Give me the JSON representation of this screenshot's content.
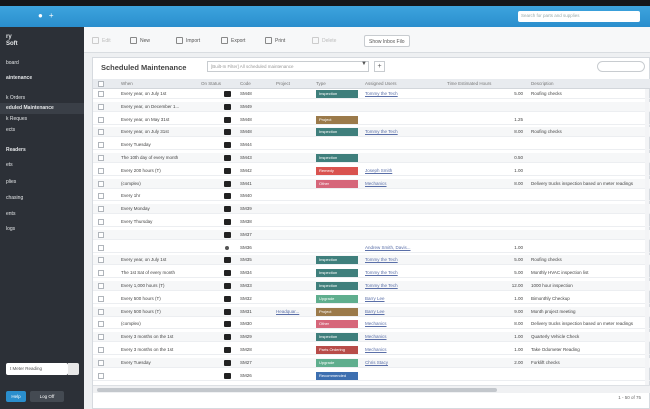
{
  "topbar": {
    "user_icon": "user-icon",
    "plus_label": "+",
    "search_placeholder": "Search for parts and supplies"
  },
  "sidebar": {
    "logo": [
      "ry",
      "Soft"
    ],
    "items": [
      {
        "label": "board"
      },
      {
        "label": "aintenance"
      },
      {
        "label": "k Orders"
      },
      {
        "label": "eduled Maintenance"
      },
      {
        "label": "k Reques"
      },
      {
        "label": "ects"
      },
      {
        "label": "Readers"
      },
      {
        "label": "ets"
      },
      {
        "label": "plies"
      },
      {
        "label": "chasing"
      },
      {
        "label": "ents"
      },
      {
        "label": "logs"
      }
    ],
    "meter_label": "t Meter Reading",
    "help_label": "Help",
    "logout_label": "Log Off"
  },
  "toolbar": {
    "edit": "Edit",
    "new": "New",
    "import": "Import",
    "export": "Export",
    "print": "Print",
    "delete": "Delete",
    "show_inbox": "Show Inbox Filo"
  },
  "panel": {
    "title": "Scheduled Maintenance",
    "filter": "[Built-In Filter] All scheduled maintenance",
    "add": "+",
    "pager": "1 - 50 of 75"
  },
  "columns": [
    "When",
    "On Status",
    "Code",
    "Project",
    "Type",
    "Assigned Users",
    "Time Estimated Hours",
    "Description"
  ],
  "colors": {
    "Inspection": "#3f7f7c",
    "Project": "#9b7a4a",
    "Remedy": "#d9534f",
    "Other": "#d6667a",
    "Upgrade": "#5fae8e",
    "Preventive": "#3b7c78",
    "Parts Ordering": "#b84c49",
    "Recommended": "#3d6fb0"
  },
  "rows": [
    {
      "when": "Every year, on July 1st",
      "status": "on",
      "code": "SM48",
      "project": "",
      "type": "Inspection",
      "assigned": "Tommy the Tech",
      "hours": "5.00",
      "desc": "Roofing checks"
    },
    {
      "when": "Every year, on December 1...",
      "status": "on",
      "code": "SM49",
      "project": "",
      "type": "",
      "assigned": "",
      "hours": "",
      "desc": ""
    },
    {
      "when": "Every year, on May 31st",
      "status": "on",
      "code": "SM48",
      "project": "",
      "type": "Project",
      "assigned": "",
      "hours": "1.25",
      "desc": ""
    },
    {
      "when": "Every year, on July 31st",
      "status": "on",
      "code": "SM48",
      "project": "",
      "type": "Inspection",
      "assigned": "Tommy the Tech",
      "hours": "8.00",
      "desc": "Roofing checks"
    },
    {
      "when": "Every Tuesday",
      "status": "on",
      "code": "SM44",
      "project": "",
      "type": "",
      "assigned": "",
      "hours": "",
      "desc": ""
    },
    {
      "when": "The 10th day of every month",
      "status": "on",
      "code": "SM43",
      "project": "",
      "type": "Inspection",
      "assigned": "",
      "hours": "0.50",
      "desc": ""
    },
    {
      "when": "Every 200 hours (T)",
      "status": "off",
      "code": "SM42",
      "project": "",
      "type": "Remedy",
      "assigned": "Joseph Smith",
      "hours": "1.00",
      "desc": ""
    },
    {
      "when": "(complex)",
      "status": "off",
      "code": "SM41",
      "project": "",
      "type": "Other",
      "assigned": "Mechanics",
      "hours": "8.00",
      "desc": "Delivery trucks inspection based on meter readings"
    },
    {
      "when": "Every 1hr",
      "status": "off",
      "code": "SM40",
      "project": "",
      "type": "",
      "assigned": "",
      "hours": "",
      "desc": ""
    },
    {
      "when": "Every Monday",
      "status": "off",
      "code": "SM39",
      "project": "",
      "type": "",
      "assigned": "",
      "hours": "",
      "desc": ""
    },
    {
      "when": "Every Thursday",
      "status": "off",
      "code": "SM38",
      "project": "",
      "type": "",
      "assigned": "",
      "hours": "",
      "desc": ""
    },
    {
      "when": "",
      "status": "on",
      "code": "SM37",
      "project": "",
      "type": "",
      "assigned": "",
      "hours": "",
      "desc": ""
    },
    {
      "when": "",
      "status": "dim",
      "code": "SM36",
      "project": "",
      "type": "",
      "assigned": "Andrew Smith, Davis...",
      "hours": "1.00",
      "desc": ""
    },
    {
      "when": "Every year, on July 1st",
      "status": "off",
      "code": "SM35",
      "project": "",
      "type": "Inspection",
      "assigned": "Tommy the Tech",
      "hours": "5.00",
      "desc": "Roofing checks"
    },
    {
      "when": "The 1st Sat of every month",
      "status": "off",
      "code": "SM34",
      "project": "",
      "type": "Inspection",
      "assigned": "Tommy the Tech",
      "hours": "5.00",
      "desc": "Monthly HVAC inspection list"
    },
    {
      "when": "Every 1,000 hours (T)",
      "status": "off",
      "code": "SM33",
      "project": "",
      "type": "Inspection",
      "assigned": "Tommy the Tech",
      "hours": "12.00",
      "desc": "1000 hour inspection"
    },
    {
      "when": "Every 500 hours (T)",
      "status": "off",
      "code": "SM32",
      "project": "",
      "type": "Upgrade",
      "assigned": "Barry Lee",
      "hours": "1.00",
      "desc": "Bimonthly Checkup"
    },
    {
      "when": "Every 500 hours (T)",
      "status": "off",
      "code": "SM31",
      "project": "Headquar...",
      "type": "Project",
      "assigned": "Barry Lee",
      "hours": "9.00",
      "desc": "Month project meeting"
    },
    {
      "when": "(complex)",
      "status": "off",
      "code": "SM30",
      "project": "",
      "type": "Other",
      "assigned": "Mechanics",
      "hours": "8.00",
      "desc": "Delivery trucks inspection based on meter readings"
    },
    {
      "when": "Every 3 months on the 1st",
      "status": "off",
      "code": "SM29",
      "project": "",
      "type": "Inspection",
      "assigned": "Mechanics",
      "hours": "1.00",
      "desc": "Quarterly Vehicle Check"
    },
    {
      "when": "Every 3 months on the 1st",
      "status": "off",
      "code": "SM28",
      "project": "",
      "type": "Parts Ordering",
      "assigned": "Mechanics",
      "hours": "1.00",
      "desc": "Take Odometer Reading"
    },
    {
      "when": "Every Tuesday",
      "status": "off",
      "code": "SM27",
      "project": "",
      "type": "Upgrade",
      "assigned": "Chris Stacy",
      "hours": "2.00",
      "desc": "Forklift checks"
    },
    {
      "when": "",
      "status": "off",
      "code": "SM26",
      "project": "",
      "type": "Recommended",
      "assigned": "",
      "hours": "",
      "desc": ""
    }
  ]
}
